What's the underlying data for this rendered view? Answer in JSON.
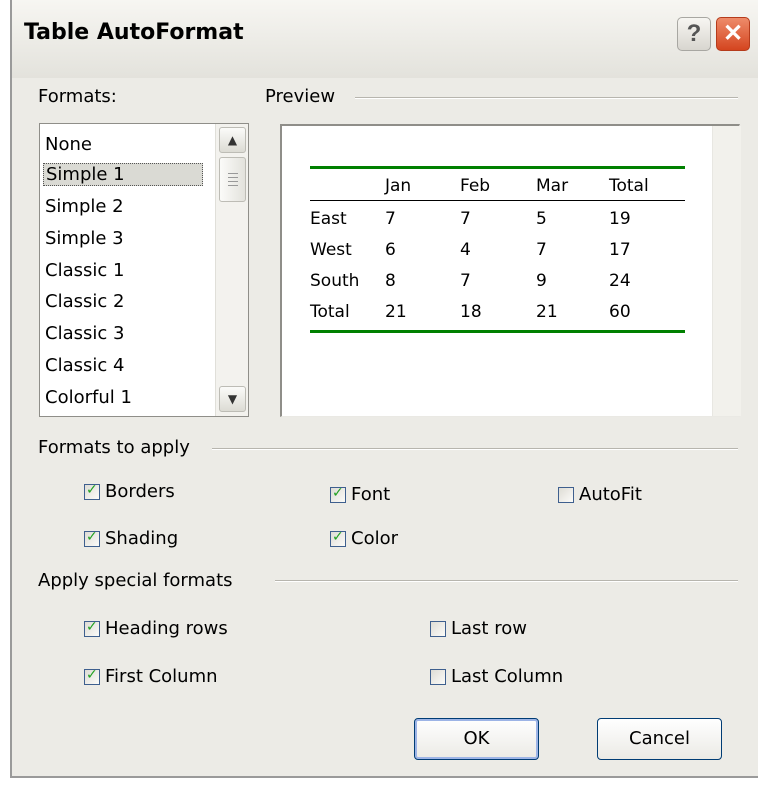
{
  "window": {
    "title": "Table AutoFormat",
    "help_glyph": "?",
    "close_glyph": "✕"
  },
  "formats": {
    "label": "Formats:",
    "items": [
      "None",
      "Simple 1",
      "Simple 2",
      "Simple 3",
      "Classic 1",
      "Classic 2",
      "Classic 3",
      "Classic 4",
      "Colorful 1"
    ],
    "selected": "Simple 1"
  },
  "preview": {
    "label": "Preview",
    "header": [
      "",
      "Jan",
      "Feb",
      "Mar",
      "Total"
    ],
    "rows": [
      [
        "East",
        "7",
        "7",
        "5",
        "19"
      ],
      [
        "West",
        "6",
        "4",
        "7",
        "17"
      ],
      [
        "South",
        "8",
        "7",
        "9",
        "24"
      ],
      [
        "Total",
        "21",
        "18",
        "21",
        "60"
      ]
    ],
    "rule_color": "#008000"
  },
  "formats_to_apply": {
    "label": "Formats to apply",
    "borders": {
      "label": "Borders",
      "checked": true
    },
    "font": {
      "label": "Font",
      "checked": true
    },
    "autofit": {
      "label": "AutoFit",
      "checked": false
    },
    "shading": {
      "label": "Shading",
      "checked": true
    },
    "color": {
      "label": "Color",
      "checked": true
    }
  },
  "special_formats": {
    "label": "Apply special formats",
    "heading_rows": {
      "label": "Heading rows",
      "checked": true
    },
    "first_column": {
      "label": "First Column",
      "checked": true
    },
    "last_row": {
      "label": "Last row",
      "checked": false
    },
    "last_column": {
      "label": "Last Column",
      "checked": false
    }
  },
  "buttons": {
    "ok": "OK",
    "cancel": "Cancel"
  },
  "icons": {
    "scroll_up": "chevron-up-icon",
    "scroll_down": "chevron-down-icon",
    "check": "checkmark-icon"
  }
}
